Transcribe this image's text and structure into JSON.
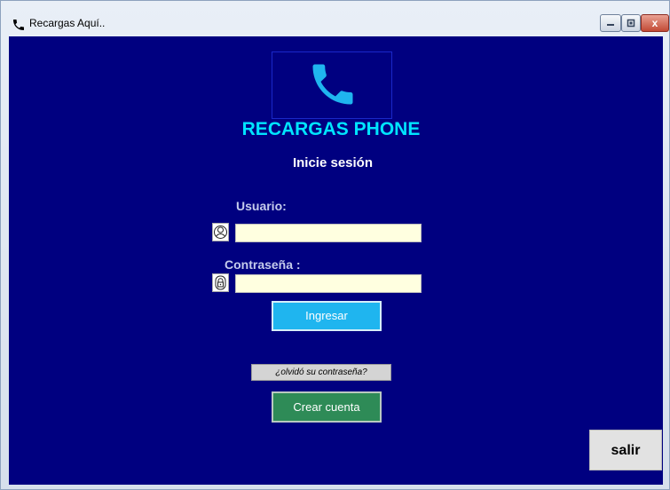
{
  "window": {
    "title": "Recargas Aquí..",
    "controls": {
      "minimize": "▭",
      "maximize": "▣",
      "close": "x"
    }
  },
  "header": {
    "logo_icon": "phone-icon",
    "brand": "RECARGAS PHONE",
    "subtitle": "Inicie sesión"
  },
  "form": {
    "user_label": "Usuario:",
    "user_value": "",
    "user_icon": "user-icon",
    "password_label": "Contraseña :",
    "password_value": "",
    "password_icon": "lock-icon",
    "login_button": "Ingresar",
    "forgot_button": "¿olvidó su contraseña?",
    "create_button": "Crear cuenta"
  },
  "footer": {
    "exit_button": "salir"
  },
  "colors": {
    "background": "#000080",
    "brand": "#00e5ff",
    "login_button": "#1fb5ef",
    "create_button": "#2e8b57",
    "input_background": "#ffffe0"
  }
}
